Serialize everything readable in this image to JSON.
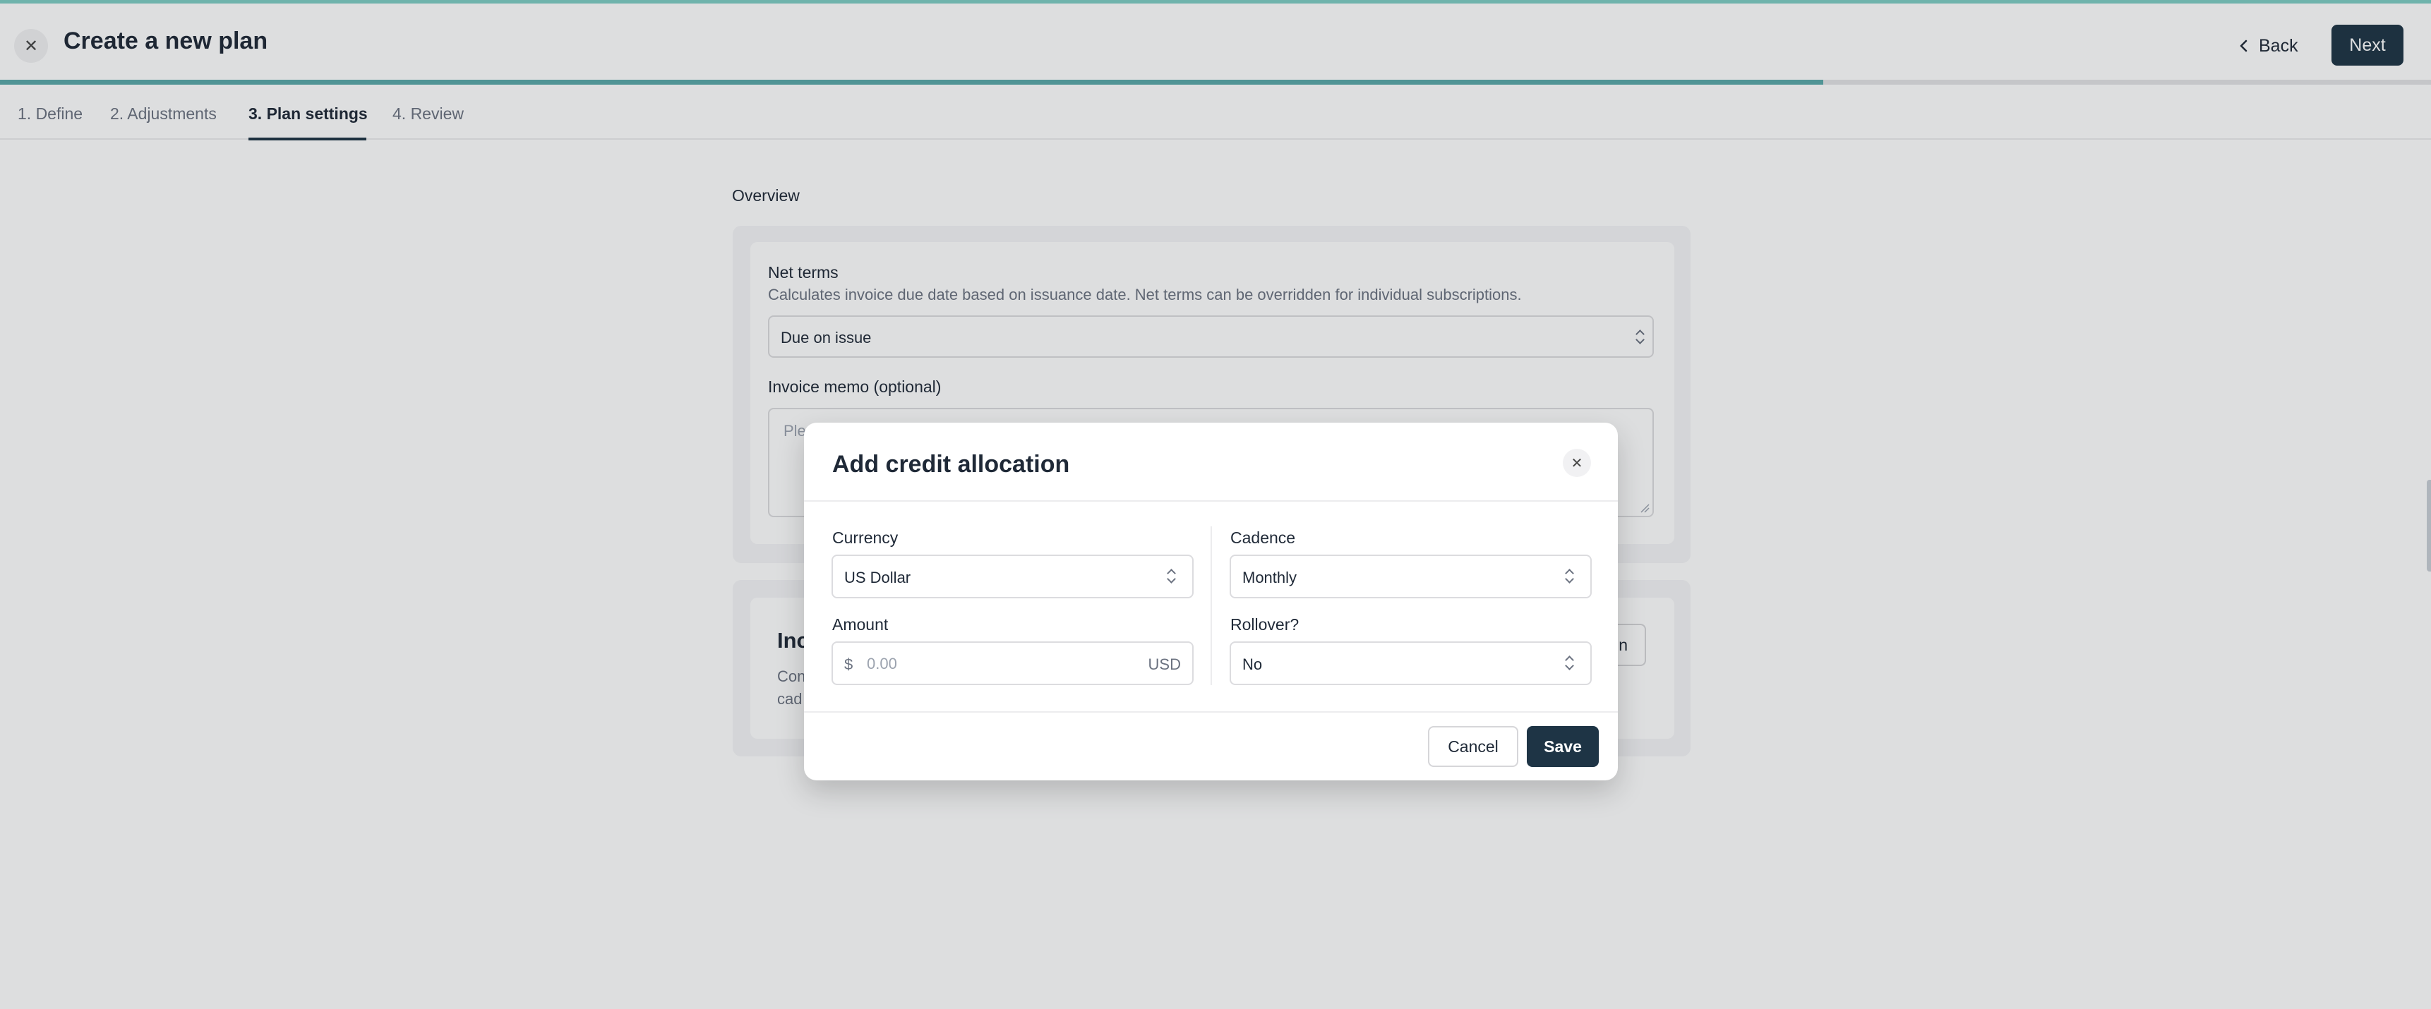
{
  "header": {
    "title": "Create a new plan",
    "back_label": "Back",
    "next_label": "Next",
    "progress_fraction": 0.75
  },
  "tabs": [
    {
      "label": "1. Define",
      "active": false
    },
    {
      "label": "2. Adjustments",
      "active": false
    },
    {
      "label": "3. Plan settings",
      "active": true
    },
    {
      "label": "4. Review",
      "active": false
    }
  ],
  "overview": {
    "section_label": "Overview",
    "net_terms": {
      "title": "Net terms",
      "description": "Calculates invoice due date based on issuance date. Net terms can be overridden for individual subscriptions.",
      "value": "Due on issue"
    },
    "invoice_memo": {
      "label": "Invoice memo (optional)",
      "placeholder_fragment": "Plea"
    }
  },
  "credits_panel": {
    "title_fragment": "Inc",
    "desc_line1_fragment": "Con",
    "desc_line2_fragment": "cad",
    "button_fragment": "n"
  },
  "modal": {
    "title": "Add credit allocation",
    "currency": {
      "label": "Currency",
      "value": "US Dollar"
    },
    "cadence": {
      "label": "Cadence",
      "value": "Monthly"
    },
    "amount": {
      "label": "Amount",
      "prefix": "$",
      "placeholder": "0.00",
      "suffix": "USD"
    },
    "rollover": {
      "label": "Rollover?",
      "value": "No"
    },
    "cancel_label": "Cancel",
    "save_label": "Save"
  },
  "colors": {
    "primary": "#1e3445",
    "accent": "#7ecdc4",
    "progress": "#5aa9a8"
  },
  "icons": {
    "close": "close-icon",
    "back": "chevron-left-icon",
    "select": "chevron-up-down-icon",
    "resize": "resize-handle-icon"
  }
}
